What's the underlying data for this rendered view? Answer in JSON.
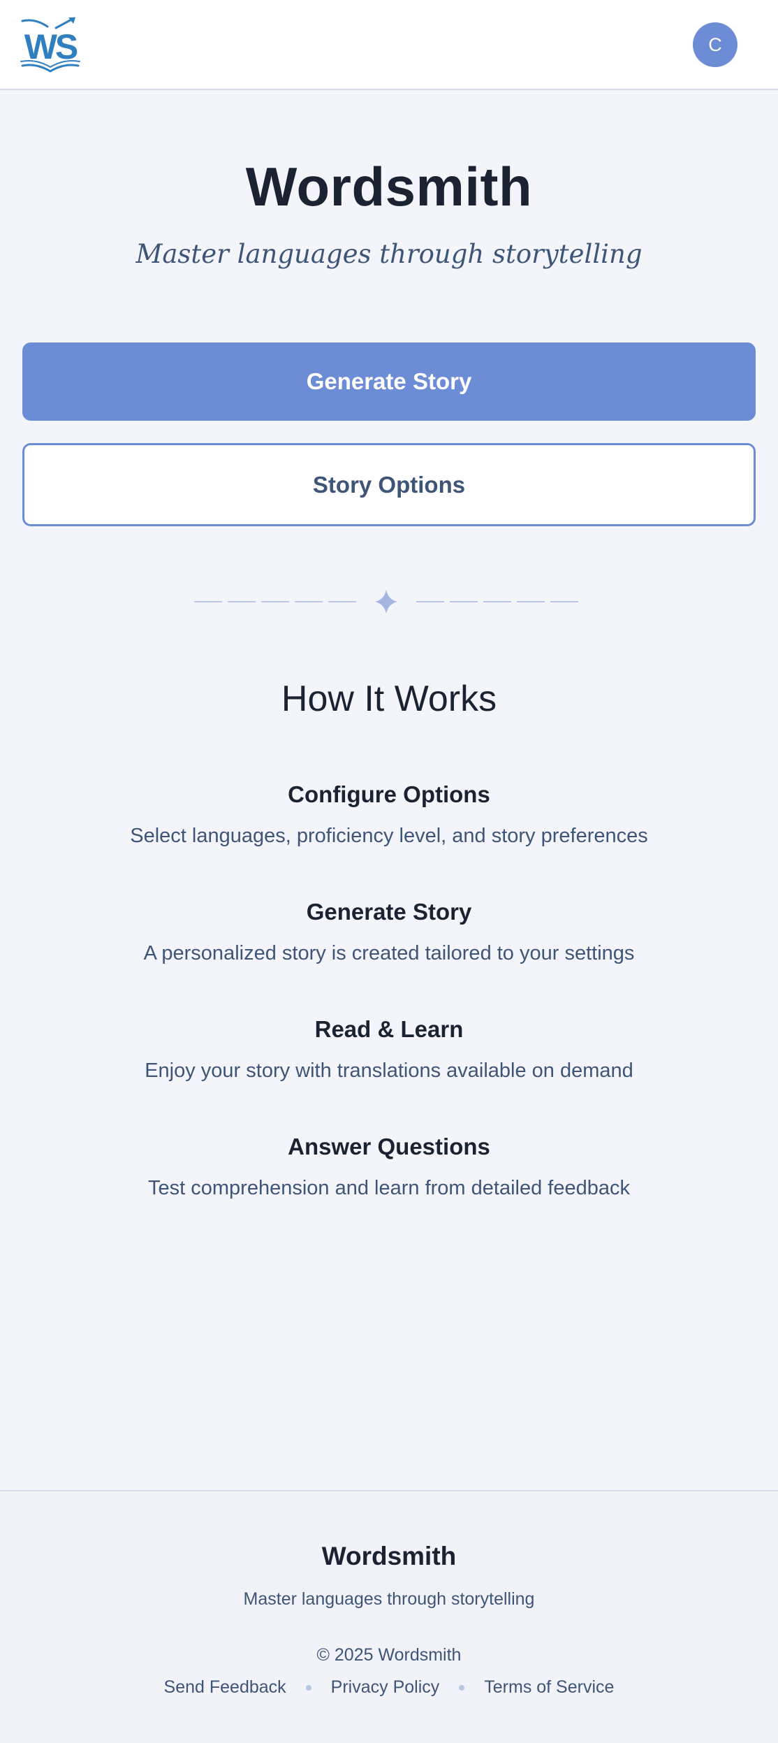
{
  "header": {
    "logo_text": "WS",
    "avatar_initial": "C"
  },
  "hero": {
    "title": "Wordsmith",
    "tagline": "Master languages through storytelling"
  },
  "actions": {
    "generate_label": "Generate Story",
    "options_label": "Story Options"
  },
  "how_it_works": {
    "title": "How It Works",
    "steps": [
      {
        "title": "Configure Options",
        "description": "Select languages, proficiency level, and story preferences"
      },
      {
        "title": "Generate Story",
        "description": "A personalized story is created tailored to your settings"
      },
      {
        "title": "Read & Learn",
        "description": "Enjoy your story with translations available on demand"
      },
      {
        "title": "Answer Questions",
        "description": "Test comprehension and learn from detailed feedback"
      }
    ]
  },
  "footer": {
    "brand": "Wordsmith",
    "tagline": "Master languages through storytelling",
    "copyright": "© 2025 Wordsmith",
    "links": [
      "Send Feedback",
      "Privacy Policy",
      "Terms of Service"
    ]
  },
  "icons": {
    "logo": "open-book-logo-icon",
    "divider": "sparkle-icon"
  },
  "colors": {
    "primary": "#6c8cd5",
    "heading": "#1b2333",
    "body_text": "#3e5577",
    "background": "#f4f5fa",
    "logo_blue": "#2f7fc1",
    "divider": "#b8c6e6"
  }
}
